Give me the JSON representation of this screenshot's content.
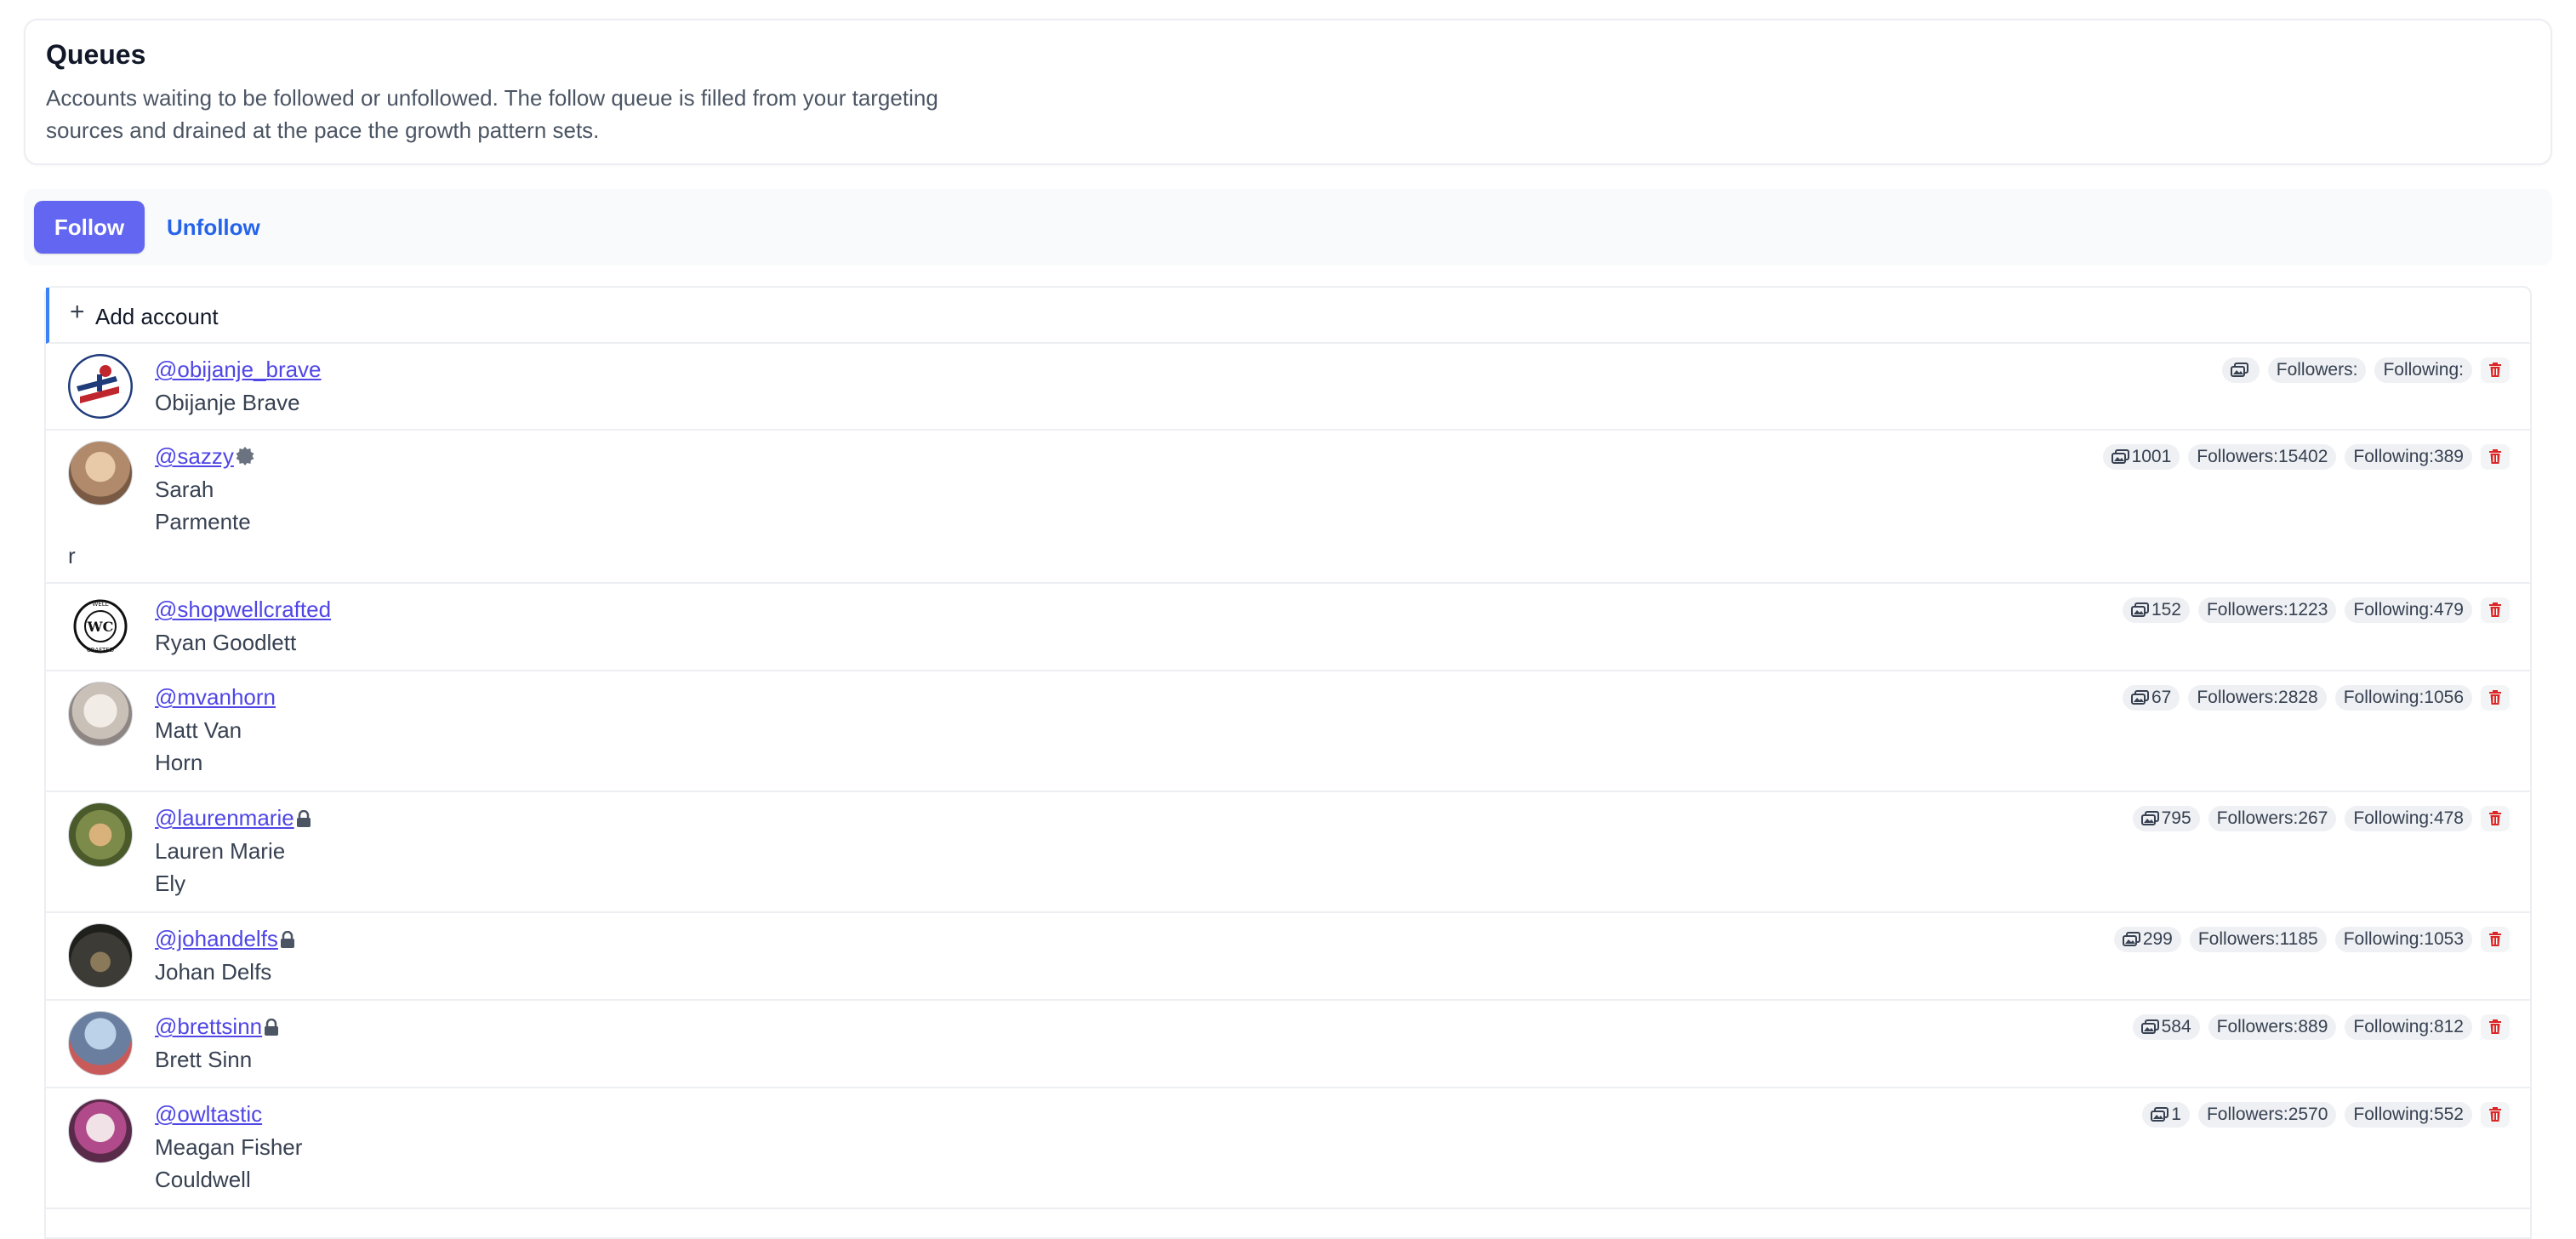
{
  "header": {
    "title": "Queues",
    "description": "Accounts waiting to be followed or unfollowed. The follow queue is filled from your targeting sources and drained at the pace the growth pattern sets."
  },
  "tabs": [
    {
      "label": "Follow",
      "active": true
    },
    {
      "label": "Unfollow",
      "active": false
    }
  ],
  "add_account": {
    "label": "Add account"
  },
  "accounts": [
    {
      "handle": "@obijanje_brave",
      "name_lines": [
        "Obijanje Brave"
      ],
      "overflow": "",
      "badge": "",
      "posts": "",
      "followers": "",
      "following": "",
      "avatar": "logo-obijanje"
    },
    {
      "handle": "@sazzy",
      "name_lines": [
        "Sarah",
        "Parmente"
      ],
      "overflow": "r",
      "badge": "verified-icon",
      "posts": "1001",
      "followers": "15402",
      "following": "389",
      "avatar": "photo"
    },
    {
      "handle": "@shopwellcrafted",
      "name_lines": [
        "Ryan Goodlett"
      ],
      "overflow": "",
      "badge": "",
      "posts": "152",
      "followers": "1223",
      "following": "479",
      "avatar": "logo-wellcrafted"
    },
    {
      "handle": "@mvanhorn",
      "name_lines": [
        "Matt Van",
        "Horn"
      ],
      "overflow": "",
      "badge": "",
      "posts": "67",
      "followers": "2828",
      "following": "1056",
      "avatar": "photo"
    },
    {
      "handle": "@laurenmarie",
      "name_lines": [
        "Lauren Marie",
        "Ely"
      ],
      "overflow": "",
      "badge": "lock-icon",
      "posts": "795",
      "followers": "267",
      "following": "478",
      "avatar": "photo"
    },
    {
      "handle": "@johandelfs",
      "name_lines": [
        "Johan Delfs"
      ],
      "overflow": "",
      "badge": "lock-icon",
      "posts": "299",
      "followers": "1185",
      "following": "1053",
      "avatar": "photo"
    },
    {
      "handle": "@brettsinn",
      "name_lines": [
        "Brett Sinn"
      ],
      "overflow": "",
      "badge": "lock-icon",
      "posts": "584",
      "followers": "889",
      "following": "812",
      "avatar": "photo"
    },
    {
      "handle": "@owltastic",
      "name_lines": [
        "Meagan Fisher",
        "Couldwell"
      ],
      "overflow": "",
      "badge": "",
      "posts": "1",
      "followers": "2570",
      "following": "552",
      "avatar": "photo"
    }
  ],
  "labels": {
    "followers": "Followers:",
    "following": "Following:"
  },
  "colors": {
    "accent": "#6366f1",
    "link": "#4f46e5",
    "danger": "#dc2626"
  },
  "icons": {
    "posts": "photos-icon",
    "delete": "trash-icon",
    "add": "plus-icon"
  }
}
